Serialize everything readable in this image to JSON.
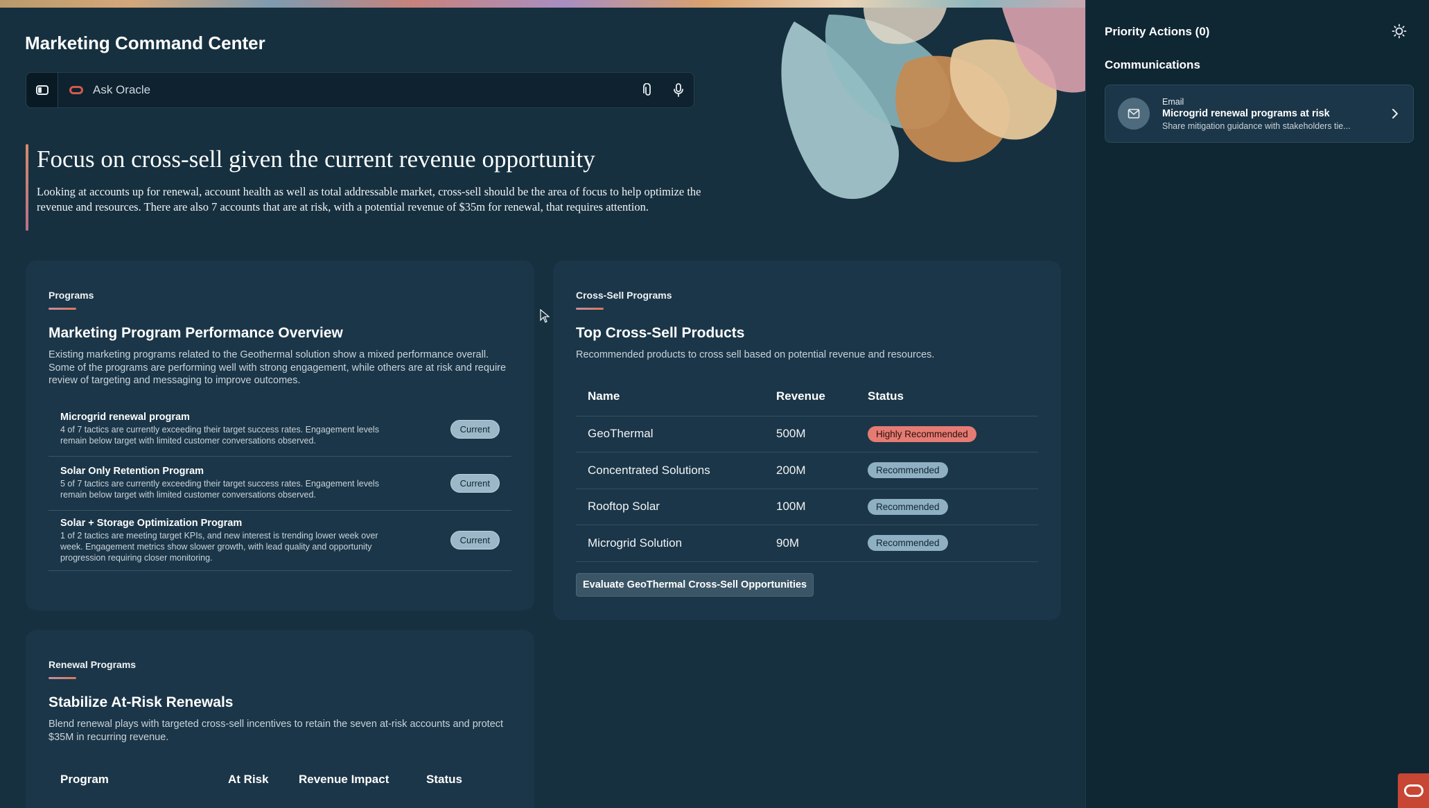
{
  "app": {
    "title": "Marketing Command Center"
  },
  "ask": {
    "placeholder": "Ask Oracle"
  },
  "hero": {
    "heading": "Focus on cross-sell given the current revenue opportunity",
    "body": "Looking at accounts up for renewal, account health as well as total addressable market, cross-sell should be the area of focus to help optimize the revenue and resources. There are also 7 accounts that are at risk, with a potential revenue of $35m for renewal, that requires attention."
  },
  "programs": {
    "eyebrow": "Programs",
    "title": "Marketing Program Performance Overview",
    "description": "Existing marketing programs related to the Geothermal solution show a mixed performance overall. Some of the programs are performing well with strong engagement, while others are at risk and require review of targeting and messaging to improve outcomes.",
    "items": [
      {
        "title": "Microgrid renewal program",
        "detail": "4 of 7 tactics are currently exceeding their target success rates. Engagement levels remain below target with limited customer conversations observed.",
        "status": "Current"
      },
      {
        "title": "Solar Only Retention Program",
        "detail": "5 of 7 tactics are currently exceeding their target success rates. Engagement levels remain below target with limited customer conversations observed.",
        "status": "Current"
      },
      {
        "title": "Solar + Storage Optimization Program",
        "detail": "1 of 2 tactics are meeting target KPIs, and new interest is trending lower week over week. Engagement metrics show slower growth, with lead quality and opportunity progression requiring closer monitoring.",
        "status": "Current"
      }
    ]
  },
  "cross_sell": {
    "eyebrow": "Cross-Sell Programs",
    "title": "Top Cross-Sell Products",
    "description": "Recommended products to cross sell based on potential revenue and resources.",
    "columns": [
      "Name",
      "Revenue",
      "Status"
    ],
    "rows": [
      {
        "name": "GeoThermal",
        "revenue": "500M",
        "status": "Highly Recommended"
      },
      {
        "name": "Concentrated Solutions",
        "revenue": "200M",
        "status": "Recommended"
      },
      {
        "name": "Rooftop Solar",
        "revenue": "100M",
        "status": "Recommended"
      },
      {
        "name": "Microgrid Solution",
        "revenue": "90M",
        "status": "Recommended"
      }
    ],
    "action_label": "Evaluate GeoThermal Cross-Sell Opportunities"
  },
  "renewals": {
    "eyebrow": "Renewal Programs",
    "title": "Stabilize At-Risk Renewals",
    "description": "Blend renewal plays with targeted cross-sell incentives to retain the seven at-risk accounts and protect $35M in recurring revenue.",
    "columns": [
      "Program",
      "At Risk",
      "Revenue Impact",
      "Status"
    ]
  },
  "sidebar": {
    "title": "Priority Actions (0)",
    "section": "Communications",
    "card": {
      "kind": "Email",
      "title": "Microgrid renewal programs at risk",
      "description": "Share mitigation guidance with stakeholders tie..."
    }
  },
  "colors": {
    "background": "#16303f",
    "card": "#1b3648",
    "sidebar": "#0f2633",
    "accent_red": "#c74634",
    "badge_hot": "#e57b73",
    "badge_rec": "#8fb0c2"
  },
  "icons": [
    "sidebar-toggle-icon",
    "oracle-logo-icon",
    "attach-icon",
    "microphone-icon",
    "sun-icon",
    "mail-icon",
    "chevron-right-icon",
    "cursor-icon"
  ]
}
